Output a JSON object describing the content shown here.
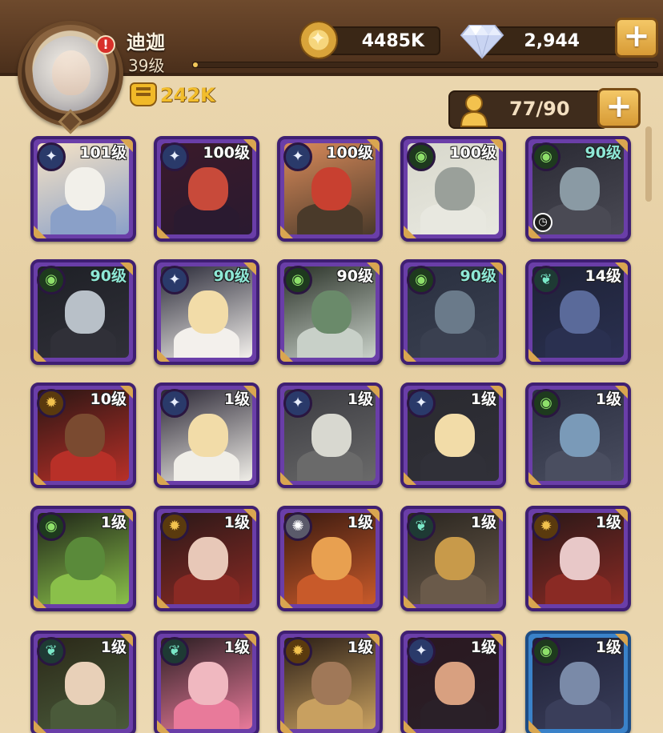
{
  "player": {
    "name": "迪迦",
    "level": "39级",
    "power": "242K",
    "notice": "!",
    "exp_fraction": 0.01
  },
  "resources": {
    "gold": "4485K",
    "diamonds": "2,944",
    "plus": "+"
  },
  "heroes_summary": {
    "count": "77/90"
  },
  "colors": {
    "card_purple": "#6a3ea8",
    "card_blue": "#3a82c9",
    "level_teal": "#8ee8d6",
    "power_gold": "#f2bd2c"
  },
  "heroes": [
    {
      "level": "101级",
      "faction": "star-icon",
      "highlight": false,
      "frame": "purple"
    },
    {
      "level": "100级",
      "faction": "star-icon",
      "highlight": false,
      "frame": "purple"
    },
    {
      "level": "100级",
      "faction": "star-icon",
      "highlight": false,
      "frame": "purple"
    },
    {
      "level": "100级",
      "faction": "eye-icon",
      "highlight": false,
      "frame": "purple"
    },
    {
      "level": "90级",
      "faction": "eye-icon",
      "highlight": true,
      "frame": "purple",
      "timer": true
    },
    {
      "level": "90级",
      "faction": "eye-icon",
      "highlight": true,
      "frame": "purple"
    },
    {
      "level": "90级",
      "faction": "star-icon",
      "highlight": true,
      "frame": "purple"
    },
    {
      "level": "90级",
      "faction": "eye-icon",
      "highlight": false,
      "frame": "purple"
    },
    {
      "level": "90级",
      "faction": "eye-icon",
      "highlight": true,
      "frame": "purple"
    },
    {
      "level": "14级",
      "faction": "leaf-icon",
      "highlight": false,
      "frame": "purple"
    },
    {
      "level": "10级",
      "faction": "sun-icon",
      "highlight": false,
      "frame": "purple"
    },
    {
      "level": "1级",
      "faction": "star-icon",
      "highlight": false,
      "frame": "purple"
    },
    {
      "level": "1级",
      "faction": "star-icon",
      "highlight": false,
      "frame": "purple"
    },
    {
      "level": "1级",
      "faction": "star-icon",
      "highlight": false,
      "frame": "purple"
    },
    {
      "level": "1级",
      "faction": "eye-icon",
      "highlight": false,
      "frame": "purple"
    },
    {
      "level": "1级",
      "faction": "eye-icon",
      "highlight": false,
      "frame": "purple"
    },
    {
      "level": "1级",
      "faction": "sun-icon",
      "highlight": false,
      "frame": "purple"
    },
    {
      "level": "1级",
      "faction": "light-icon",
      "highlight": false,
      "frame": "purple"
    },
    {
      "level": "1级",
      "faction": "leaf-icon",
      "highlight": false,
      "frame": "purple"
    },
    {
      "level": "1级",
      "faction": "sun-icon",
      "highlight": false,
      "frame": "purple"
    },
    {
      "level": "1级",
      "faction": "leaf-icon",
      "highlight": false,
      "frame": "purple"
    },
    {
      "level": "1级",
      "faction": "leaf-icon",
      "highlight": false,
      "frame": "purple"
    },
    {
      "level": "1级",
      "faction": "sun-icon",
      "highlight": false,
      "frame": "purple"
    },
    {
      "level": "1级",
      "faction": "star-icon",
      "highlight": false,
      "frame": "purple"
    },
    {
      "level": "1级",
      "faction": "eye-icon",
      "highlight": false,
      "frame": "blue"
    }
  ]
}
